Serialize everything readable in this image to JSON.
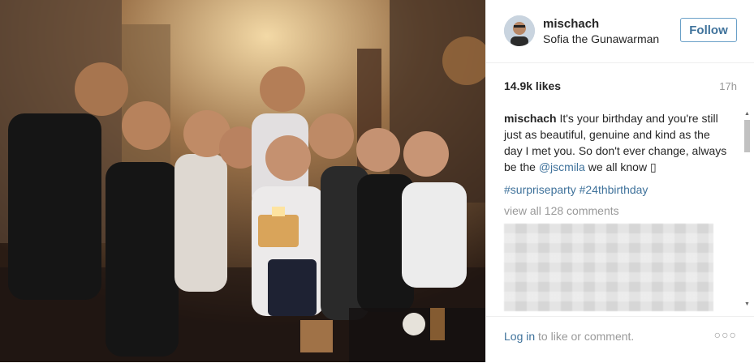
{
  "post": {
    "username": "mischach",
    "location": "Sofia the Gunawarman",
    "follow_label": "Follow",
    "likes": "14.9k likes",
    "time": "17h",
    "caption_user": "mischach",
    "caption_text_before": " It's your birthday and you're still just as beautiful, genuine and kind as the day I met you. So don't ever change, always be the ",
    "caption_mention": "@jscmila",
    "caption_text_after": " we all know",
    "caption_emoji": "▯",
    "hashtags": "#surpriseparty #24thbirthday",
    "view_all": "view all 128 comments",
    "login_link": "Log in",
    "login_rest": " to like or comment.",
    "more": "○○○"
  },
  "icons": {
    "scroll_up": "▲",
    "scroll_down": "▼"
  },
  "colors": {
    "link": "#3f729b",
    "muted": "#999999",
    "text": "#262626"
  }
}
